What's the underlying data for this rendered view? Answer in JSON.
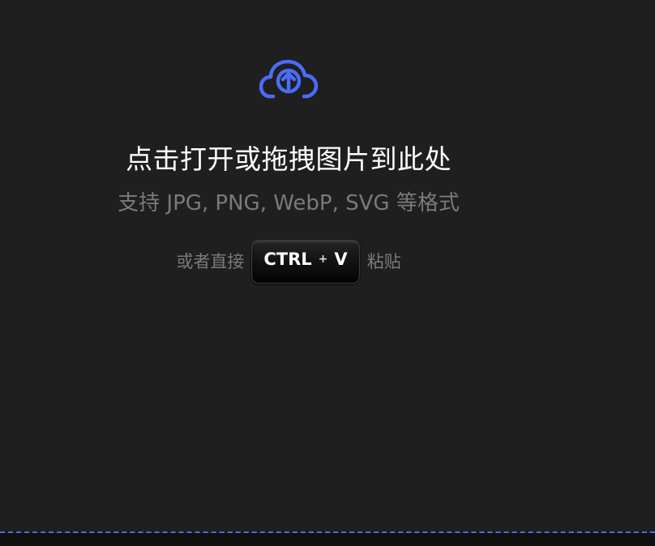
{
  "upload": {
    "icon": "cloud-upload-icon",
    "accent_color": "#4a6cf7",
    "title": "点击打开或拖拽图片到此处",
    "formats": "支持 JPG, PNG, WebP, SVG 等格式",
    "paste_prefix": "或者直接",
    "paste_suffix": "粘贴",
    "shortcut": {
      "ctrl": "CTRL",
      "plus": "+",
      "key": "V"
    }
  }
}
